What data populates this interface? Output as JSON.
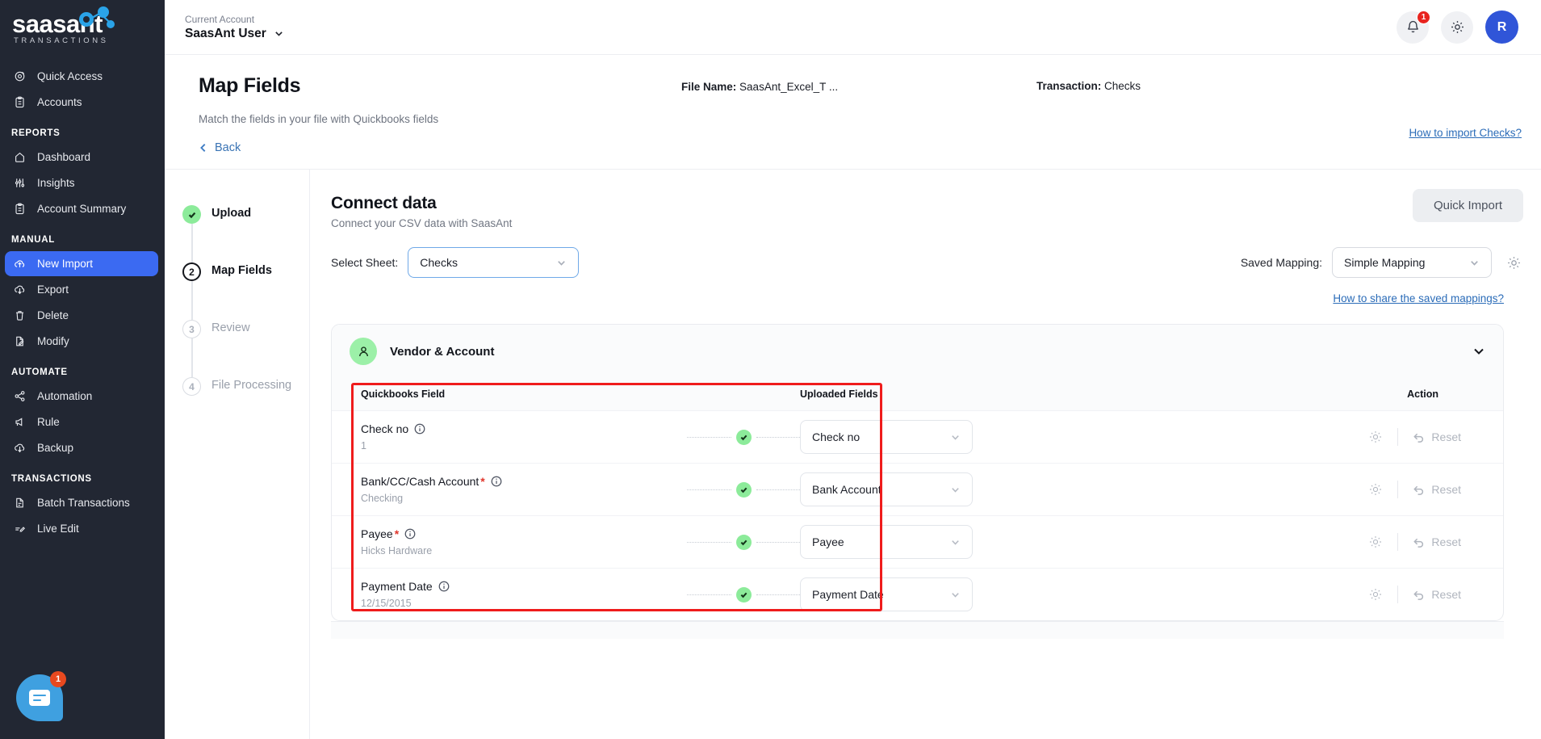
{
  "brand": {
    "name": "saasant",
    "tagline": "TRANSACTIONS",
    "accent": "#3b6af2",
    "dot_color": "#2aa3e8"
  },
  "sidebar": {
    "groups": [
      {
        "title": null,
        "items": [
          {
            "label": "Quick Access",
            "icon": "target-icon",
            "active": false
          },
          {
            "label": "Accounts",
            "icon": "clipboard-icon",
            "active": false
          }
        ]
      },
      {
        "title": "REPORTS",
        "items": [
          {
            "label": "Dashboard",
            "icon": "home-icon",
            "active": false
          },
          {
            "label": "Insights",
            "icon": "sliders-icon",
            "active": false
          },
          {
            "label": "Account Summary",
            "icon": "clipboard-icon",
            "active": false
          }
        ]
      },
      {
        "title": "MANUAL",
        "items": [
          {
            "label": "New Import",
            "icon": "upload-cloud-icon",
            "active": true
          },
          {
            "label": "Export",
            "icon": "download-icon",
            "active": false
          },
          {
            "label": "Delete",
            "icon": "trash-icon",
            "active": false
          },
          {
            "label": "Modify",
            "icon": "file-edit-icon",
            "active": false
          }
        ]
      },
      {
        "title": "AUTOMATE",
        "items": [
          {
            "label": "Automation",
            "icon": "share-nodes-icon",
            "active": false
          },
          {
            "label": "Rule",
            "icon": "megaphone-icon",
            "active": false
          },
          {
            "label": "Backup",
            "icon": "download-icon",
            "active": false
          }
        ]
      },
      {
        "title": "TRANSACTIONS",
        "items": [
          {
            "label": "Batch Transactions",
            "icon": "document-icon",
            "active": false
          },
          {
            "label": "Live Edit",
            "icon": "pencil-line-icon",
            "active": false
          }
        ]
      }
    ],
    "chat_badge": "1"
  },
  "topbar": {
    "account_label": "Current Account",
    "account_name": "SaasAnt User",
    "notification_badge": "1",
    "avatar_initial": "R"
  },
  "page": {
    "title": "Map Fields",
    "subtitle": "Match the fields in your file with Quickbooks fields",
    "file_name_label": "File Name:",
    "file_name_value": "SaasAnt_Excel_T ...",
    "transaction_label": "Transaction:",
    "transaction_value": "Checks",
    "how_to_import_link": "How to import Checks?",
    "back_label": "Back"
  },
  "stepper": {
    "steps": [
      {
        "num": "1",
        "label": "Upload",
        "state": "done"
      },
      {
        "num": "2",
        "label": "Map Fields",
        "state": "current"
      },
      {
        "num": "3",
        "label": "Review",
        "state": "todo"
      },
      {
        "num": "4",
        "label": "File Processing",
        "state": "todo"
      }
    ]
  },
  "connect": {
    "title": "Connect data",
    "subtitle": "Connect your CSV data with SaasAnt",
    "quick_import_label": "Quick Import",
    "select_sheet_label": "Select Sheet:",
    "select_sheet_value": "Checks",
    "saved_mapping_label": "Saved Mapping:",
    "saved_mapping_value": "Simple Mapping",
    "share_mappings_link": "How to share the saved mappings?"
  },
  "section": {
    "title": "Vendor & Account",
    "icon": "user-icon",
    "expanded": true,
    "highlight_color": "#ef1c1c"
  },
  "table": {
    "headers": {
      "quickbooks_field": "Quickbooks Field",
      "uploaded_fields": "Uploaded Fields",
      "action": "Action"
    },
    "reset_label": "Reset",
    "rows": [
      {
        "qb_field": "Check no",
        "required": false,
        "sample": "1",
        "mapped": "Check no",
        "status": "matched"
      },
      {
        "qb_field": "Bank/CC/Cash Account",
        "required": true,
        "sample": "Checking",
        "mapped": "Bank Account",
        "status": "matched"
      },
      {
        "qb_field": "Payee",
        "required": true,
        "sample": "Hicks Hardware",
        "mapped": "Payee",
        "status": "matched"
      },
      {
        "qb_field": "Payment Date",
        "required": false,
        "sample": "12/15/2015",
        "mapped": "Payment Date",
        "status": "matched"
      }
    ]
  }
}
